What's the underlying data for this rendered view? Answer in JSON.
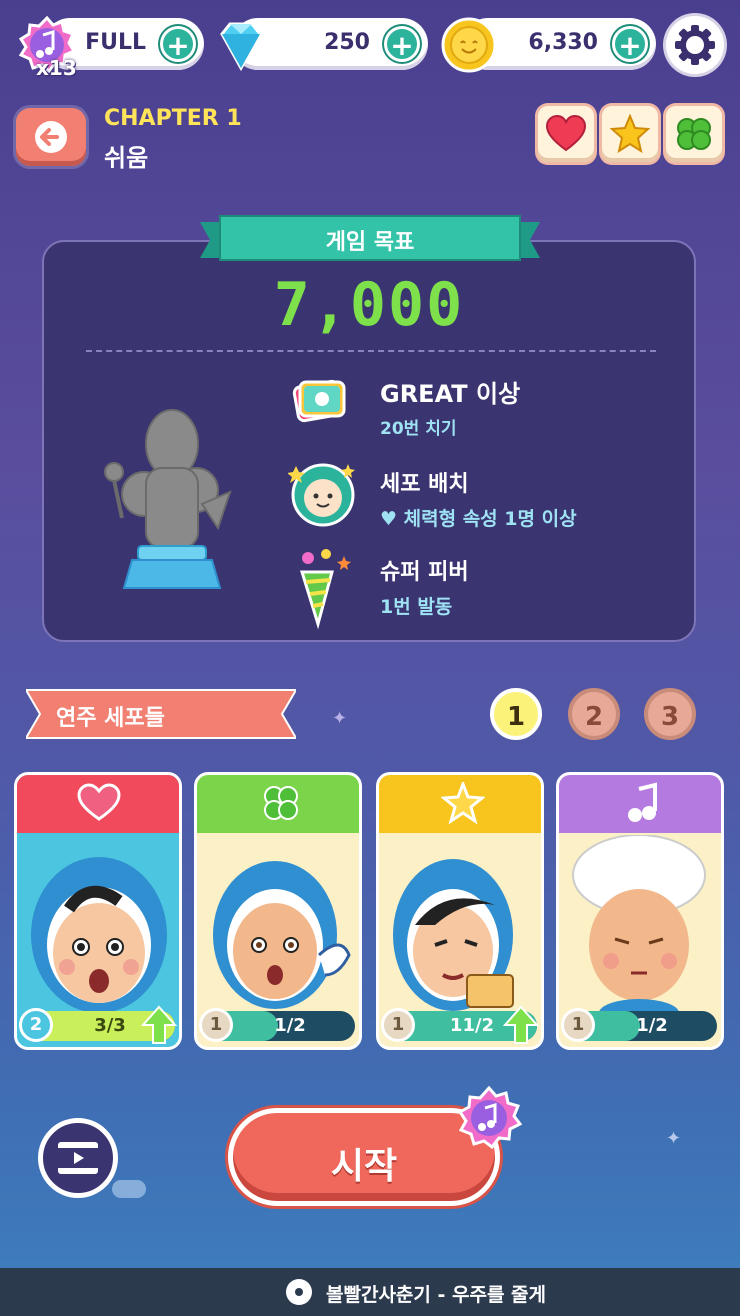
{
  "topbar": {
    "energy": {
      "badge": "x13",
      "value": "FULL",
      "icon": "music-note-icon"
    },
    "gems": {
      "value": "250",
      "icon": "diamond-icon"
    },
    "coins": {
      "value": "6,330",
      "icon": "coin-icon"
    },
    "settings_icon": "gear-icon"
  },
  "header": {
    "chapter": "CHAPTER 1",
    "difficulty": "쉬움",
    "attributes": [
      "heart-icon",
      "star-icon",
      "clover-icon"
    ]
  },
  "goal": {
    "title": "게임 목표",
    "score": "7,000",
    "missions": [
      {
        "title": "GREAT 이상",
        "detail": "20번 치기",
        "icon": "cards-icon"
      },
      {
        "title": "세포 배치",
        "detail": "♥ 체력형 속성 1명 이상",
        "icon": "cell-face-icon"
      },
      {
        "title": "슈퍼 피버",
        "detail": "1번 발동",
        "icon": "party-popper-icon"
      }
    ]
  },
  "cells": {
    "title": "연주 세포들",
    "pages": [
      "1",
      "2",
      "3"
    ],
    "active_page": "1",
    "cards": [
      {
        "attr": "heart",
        "level": "2",
        "progress": "3/3",
        "fill": 1.0,
        "upgrade": true,
        "color": "#f04a5c"
      },
      {
        "attr": "clover",
        "level": "1",
        "progress": "1/2",
        "fill": 0.5,
        "upgrade": false,
        "color": "#7bd44a"
      },
      {
        "attr": "star",
        "level": "1",
        "progress": "11/2",
        "fill": 1.0,
        "upgrade": true,
        "color": "#f7c51e"
      },
      {
        "attr": "note",
        "level": "1",
        "progress": "1/2",
        "fill": 0.5,
        "upgrade": false,
        "color": "#b57ae0"
      }
    ]
  },
  "actions": {
    "start": "시작",
    "video_icon": "film-icon"
  },
  "footer": {
    "now_playing": "볼빨간사춘기 - 우주를 줄게",
    "icon": "disc-icon"
  },
  "colors": {
    "accent": "#2bb39b",
    "start": "#f0685c",
    "score": "#7ee04a"
  }
}
